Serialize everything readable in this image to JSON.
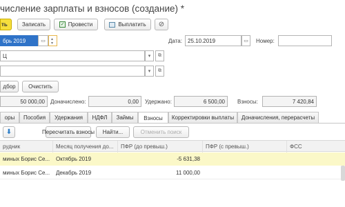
{
  "window": {
    "title": "числение зарплаты и взносов (создание) *"
  },
  "toolbar": {
    "post_close": "ть",
    "save": "Записать",
    "post": "Провести",
    "pay": "Выплатить"
  },
  "header": {
    "month_value": "брь 2019",
    "date_label": "Дата:",
    "date_value": "25.10.2019",
    "number_label": "Номер:",
    "number_value": "",
    "org_value": "Ц",
    "dept_value": ""
  },
  "actions": {
    "select": "дбор",
    "clear": "Очистить"
  },
  "totals": {
    "accrued_total": "50 000,00",
    "deducted_label": "Доначислено:",
    "deducted_value": "0,00",
    "withheld_label": "Удержано:",
    "withheld_value": "6 500,00",
    "contrib_label": "Взносы:",
    "contrib_value": "7 420,84"
  },
  "tabs": [
    {
      "label": "оры"
    },
    {
      "label": "Пособия"
    },
    {
      "label": "Удержания"
    },
    {
      "label": "НДФЛ"
    },
    {
      "label": "Займы"
    },
    {
      "label": "Взносы"
    },
    {
      "label": "Корректировки выплаты"
    },
    {
      "label": "Доначисления, перерасчеты"
    }
  ],
  "table_toolbar": {
    "recalc": "Пересчитать взносы",
    "find": "Найти...",
    "cancel_search": "Отменить поиск"
  },
  "table": {
    "columns": [
      "рудник",
      "Месяц получения до...",
      "ПФР (до превыш.)",
      "ПФР (с превыш.)",
      "ФСС"
    ],
    "rows": [
      {
        "employee": "миных Борис Се...",
        "month": "Октябрь 2019",
        "pfr_before": "-5 631,38",
        "pfr_after": "",
        "fss": ""
      },
      {
        "employee": "миных Борис Се...",
        "month": "Декабрь 2019",
        "pfr_before": "11 000,00",
        "pfr_after": "",
        "fss": ""
      }
    ]
  },
  "colors": {
    "accent": "#f6df3c",
    "selected_row": "#fbf8c8"
  }
}
